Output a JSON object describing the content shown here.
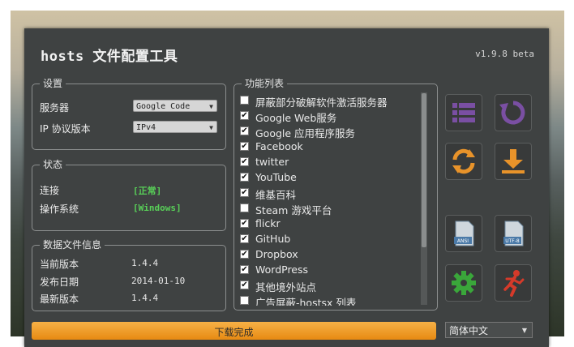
{
  "window": {
    "title": "hosts 文件配置工具",
    "version": "v1.9.8 beta"
  },
  "settings": {
    "group_title": "设置",
    "server_label": "服务器",
    "server_value": "Google Code",
    "ip_label": "IP 协议版本",
    "ip_value": "IPv4"
  },
  "status": {
    "group_title": "状态",
    "connection_label": "连接",
    "connection_value": "[正常]",
    "os_label": "操作系统",
    "os_value": "[Windows]"
  },
  "data_info": {
    "group_title": "数据文件信息",
    "current_label": "当前版本",
    "current_value": "1.4.4",
    "release_label": "发布日期",
    "release_value": "2014-01-10",
    "latest_label": "最新版本",
    "latest_value": "1.4.4"
  },
  "functions": {
    "group_title": "功能列表",
    "items": [
      {
        "label": "屏蔽部分破解软件激活服务器",
        "checked": false
      },
      {
        "label": "Google Web服务",
        "checked": true
      },
      {
        "label": "Google 应用程序服务",
        "checked": true
      },
      {
        "label": "Facebook",
        "checked": true
      },
      {
        "label": "twitter",
        "checked": true
      },
      {
        "label": "YouTube",
        "checked": true
      },
      {
        "label": "维基百科",
        "checked": true
      },
      {
        "label": "Steam 游戏平台",
        "checked": false
      },
      {
        "label": "flickr",
        "checked": true
      },
      {
        "label": "GitHub",
        "checked": true
      },
      {
        "label": "Dropbox",
        "checked": true
      },
      {
        "label": "WordPress",
        "checked": true
      },
      {
        "label": "其他境外站点",
        "checked": true
      },
      {
        "label": "广告屏蔽-hostsx 列表",
        "checked": false
      }
    ]
  },
  "actions": {
    "ansi_label": "ANSI",
    "utf8_label": "UTF-8"
  },
  "progress": {
    "text": "下载完成",
    "percent": 100
  },
  "language": {
    "value": "简体中文"
  },
  "colors": {
    "accent_purple": "#7a4fa3",
    "accent_orange": "#e8932a",
    "accent_green": "#3aa63a",
    "accent_red": "#d63a2a",
    "status_ok": "#58d058"
  }
}
